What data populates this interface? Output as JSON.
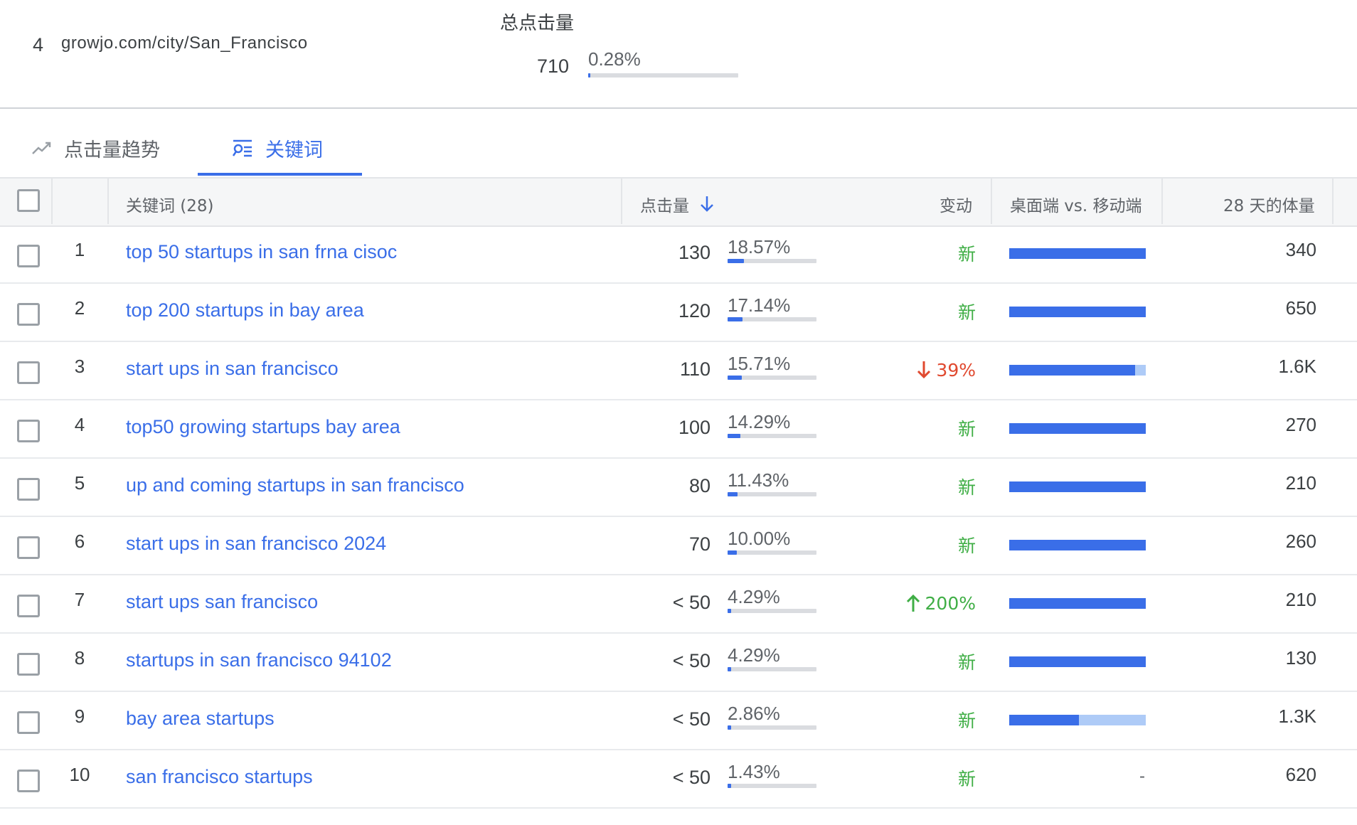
{
  "summary": {
    "rank": "4",
    "url": "growjo.com/city/San_Francisco",
    "total_label": "总点击量",
    "total_value": "710",
    "total_pct": "0.28%",
    "total_pct_fraction": 0.0028
  },
  "tabs": [
    {
      "label": "点击量趋势",
      "icon": "trend-icon",
      "active": false
    },
    {
      "label": "关键词",
      "icon": "keyword-list-icon",
      "active": true
    }
  ],
  "table": {
    "headers": {
      "keyword": "关键词 (28)",
      "clicks": "点击量",
      "change": "变动",
      "desktop_mobile": "桌面端 vs. 移动端",
      "volume": "28 天的体量"
    },
    "rows": [
      {
        "no": "1",
        "keyword": "top 50 startups in san frna cisoc",
        "clicks": "130",
        "pct": "18.57%",
        "pct_value": 0.1857,
        "change": "新",
        "change_type": "new",
        "desktop_share": 1.0,
        "volume": "340"
      },
      {
        "no": "2",
        "keyword": "top 200 startups in bay area",
        "clicks": "120",
        "pct": "17.14%",
        "pct_value": 0.1714,
        "change": "新",
        "change_type": "new",
        "desktop_share": 1.0,
        "volume": "650"
      },
      {
        "no": "3",
        "keyword": "start ups in san francisco",
        "clicks": "110",
        "pct": "15.71%",
        "pct_value": 0.1571,
        "change": "39%",
        "change_type": "down",
        "desktop_share": 0.92,
        "volume": "1.6K"
      },
      {
        "no": "4",
        "keyword": "top50 growing startups bay area",
        "clicks": "100",
        "pct": "14.29%",
        "pct_value": 0.1429,
        "change": "新",
        "change_type": "new",
        "desktop_share": 1.0,
        "volume": "270"
      },
      {
        "no": "5",
        "keyword": "up and coming startups in san francisco",
        "clicks": "80",
        "pct": "11.43%",
        "pct_value": 0.1143,
        "change": "新",
        "change_type": "new",
        "desktop_share": 1.0,
        "volume": "210"
      },
      {
        "no": "6",
        "keyword": "start ups in san francisco 2024",
        "clicks": "70",
        "pct": "10.00%",
        "pct_value": 0.1,
        "change": "新",
        "change_type": "new",
        "desktop_share": 1.0,
        "volume": "260"
      },
      {
        "no": "7",
        "keyword": "start ups san francisco",
        "clicks": "< 50",
        "pct": "4.29%",
        "pct_value": 0.0429,
        "change": "200%",
        "change_type": "up",
        "desktop_share": 1.0,
        "volume": "210"
      },
      {
        "no": "8",
        "keyword": "startups in san francisco 94102",
        "clicks": "< 50",
        "pct": "4.29%",
        "pct_value": 0.0429,
        "change": "新",
        "change_type": "new",
        "desktop_share": 1.0,
        "volume": "130"
      },
      {
        "no": "9",
        "keyword": "bay area startups",
        "clicks": "< 50",
        "pct": "2.86%",
        "pct_value": 0.0286,
        "change": "新",
        "change_type": "new",
        "desktop_share": 0.51,
        "volume": "1.3K"
      },
      {
        "no": "10",
        "keyword": "san francisco startups",
        "clicks": "< 50",
        "pct": "1.43%",
        "pct_value": 0.0143,
        "change": "新",
        "change_type": "new",
        "desktop_share": null,
        "desktop_display": "-",
        "volume": "620"
      }
    ]
  },
  "colors": {
    "accent": "#3a6ee8",
    "new": "#3fae45",
    "down": "#e0492f",
    "mobile": "#aecbf7"
  }
}
